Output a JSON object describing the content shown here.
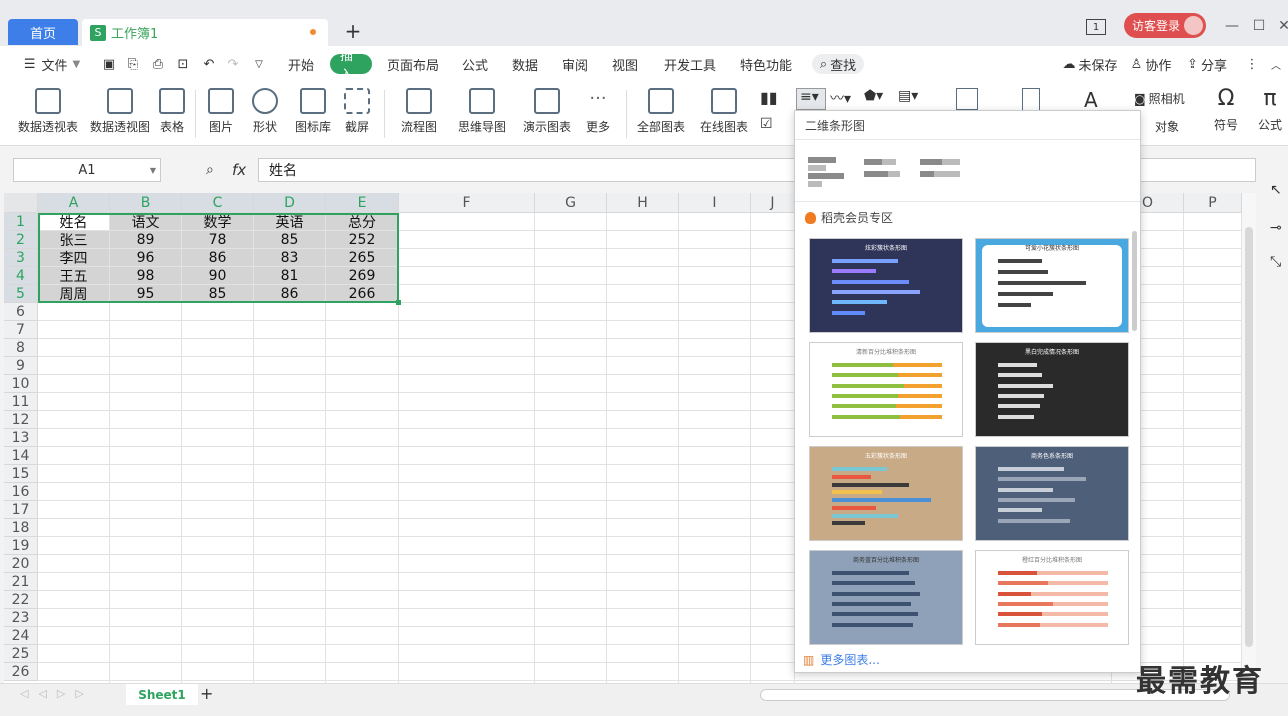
{
  "tabs": {
    "home": "首页",
    "doc": "工作簿1",
    "add": "+"
  },
  "titlebar": {
    "counter": "1",
    "login": "访客登录"
  },
  "menu": {
    "file": "文件",
    "items": [
      "开始",
      "插入",
      "页面布局",
      "公式",
      "数据",
      "审阅",
      "视图",
      "开发工具",
      "特色功能"
    ],
    "search": "查找",
    "unsaved": "未保存",
    "collab": "协作",
    "share": "分享"
  },
  "ribbon": {
    "buttons": [
      "数据透视表",
      "数据透视图",
      "表格",
      "图片",
      "形状",
      "图标库",
      "截屏",
      "流程图",
      "思维导图",
      "演示图表",
      "更多",
      "全部图表",
      "在线图表"
    ],
    "right": [
      "照相机",
      "对象",
      "符号",
      "公式"
    ]
  },
  "formula": {
    "cell_ref": "A1",
    "fx": "fx",
    "value": "姓名"
  },
  "sheet": {
    "columns": [
      "A",
      "B",
      "C",
      "D",
      "E",
      "F",
      "G",
      "H",
      "I",
      "J",
      "O",
      "P"
    ],
    "rows": [
      "1",
      "2",
      "3",
      "4",
      "5",
      "6",
      "7",
      "8",
      "9",
      "10",
      "11",
      "12",
      "13",
      "14",
      "15",
      "16",
      "17",
      "18",
      "19",
      "20",
      "21",
      "22",
      "23",
      "24",
      "25",
      "26"
    ],
    "data": [
      [
        "姓名",
        "语文",
        "数学",
        "英语",
        "总分"
      ],
      [
        "张三",
        "89",
        "78",
        "85",
        "252"
      ],
      [
        "李四",
        "96",
        "86",
        "83",
        "265"
      ],
      [
        "王五",
        "98",
        "90",
        "81",
        "269"
      ],
      [
        "周周",
        "95",
        "85",
        "86",
        "266"
      ]
    ],
    "tab": "Sheet1"
  },
  "popup": {
    "title": "二维条形图",
    "member_title": "稻壳会员专区",
    "templates": [
      "炫彩簇状条形图",
      "可爱小花簇状条形图",
      "清新百分比堆积条形图",
      "黑白完成情况条形图",
      "五彩簇状条形图",
      "商务色系条形图",
      "商务蓝百分比堆积条形图",
      "橙红百分比堆积条形图"
    ],
    "more": "更多图表..."
  },
  "watermark": "最需教育",
  "colors": {
    "accent": "#2ea360",
    "home_tab": "#3d7ee8",
    "login": "#e04f4f"
  }
}
